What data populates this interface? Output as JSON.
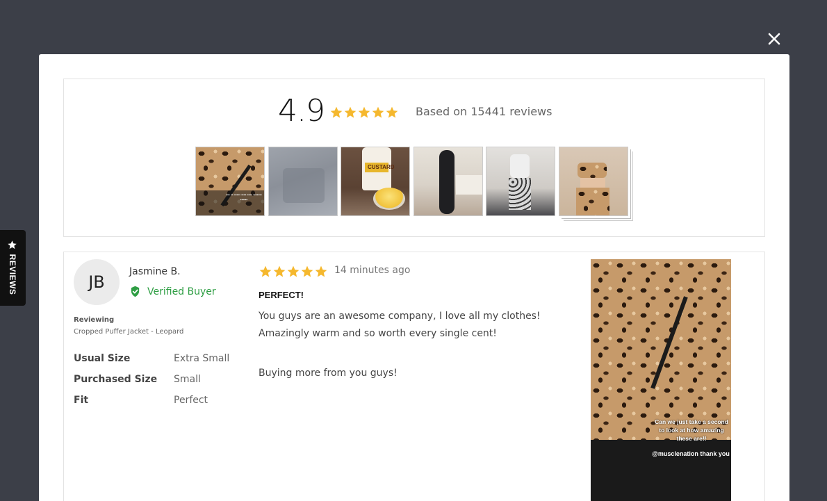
{
  "floating_tab": {
    "label": "REVIEWS",
    "icon": "star-icon"
  },
  "close_icon": "close-icon",
  "summary": {
    "average": "4.9",
    "rating_stars": 5,
    "based_on": "Based on 15441 reviews",
    "photos": [
      {
        "name": "review-photo-leopard-jacket"
      },
      {
        "name": "review-photo-grey-sweater"
      },
      {
        "name": "review-photo-custard"
      },
      {
        "name": "review-photo-black-leggings"
      },
      {
        "name": "review-photo-mirror-selfie"
      },
      {
        "name": "review-photo-leopard-set"
      }
    ]
  },
  "review": {
    "initials": "JB",
    "name": "Jasmine B.",
    "verified": "Verified Buyer",
    "reviewing_label": "Reviewing",
    "product": "Cropped Puffer Jacket - Leopard",
    "attributes": [
      {
        "key": "Usual Size",
        "value": "Extra Small"
      },
      {
        "key": "Purchased Size",
        "value": "Small"
      },
      {
        "key": "Fit",
        "value": "Perfect"
      }
    ],
    "stars": 5,
    "time": "14 minutes ago",
    "title": "PERFECT!",
    "body": "You guys are an awesome company, I love all my clothes! Amazingly warm and so worth every single cent!",
    "body2": "Buying more from you guys!",
    "photo_caption": "Can we just take a second to look at how amazing these are!!",
    "photo_caption2": "@musclenation thank you"
  },
  "colors": {
    "star": "#f5b82e",
    "verified": "#2f9e44",
    "overlay": "#3c3f48"
  }
}
